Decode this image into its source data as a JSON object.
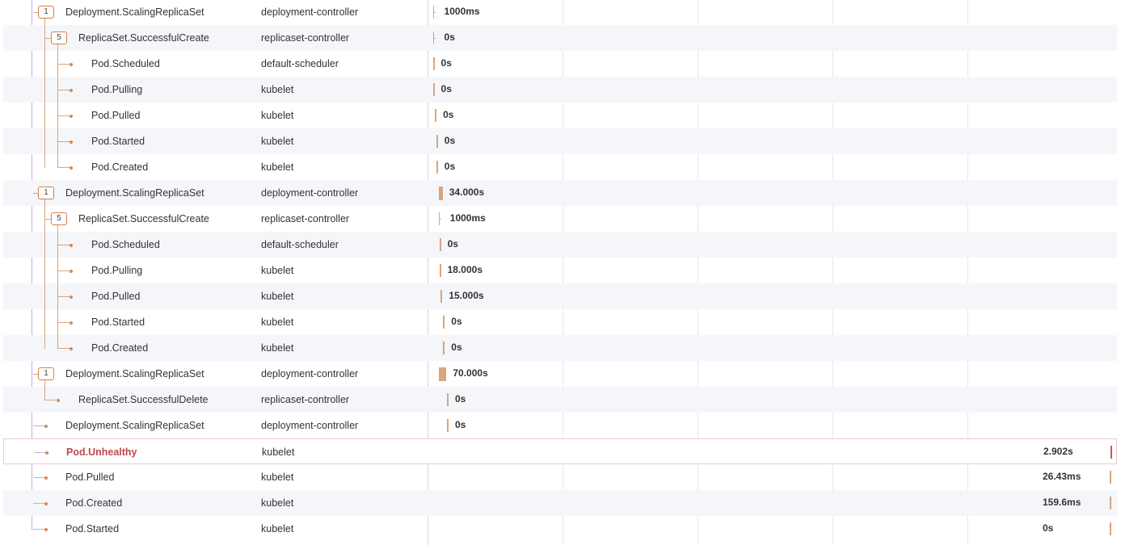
{
  "colors": {
    "bar": "#d9a47e",
    "tree_line": "#d9a47e",
    "root_line": "#c3aee0",
    "unhealthy": "#c0484f",
    "unhealthy_bar": "#d9505c"
  },
  "rows": [
    {
      "level": 1,
      "count": "1",
      "name": "Deployment.ScalingReplicaSet",
      "source": "deployment-controller",
      "duration": "1000ms",
      "bar_kind": "tick",
      "bar_start": 0.003,
      "bar_width": 0.003
    },
    {
      "level": 2,
      "count": "5",
      "name": "ReplicaSet.SuccessfulCreate",
      "source": "replicaset-controller",
      "duration": "0s",
      "bar_kind": "tick",
      "bar_start": 0.003,
      "bar_width": 0.003
    },
    {
      "level": 3,
      "name": "Pod.Scheduled",
      "source": "default-scheduler",
      "duration": "0s",
      "bar_kind": "thin",
      "bar_start": 0.003,
      "bar_width": 0
    },
    {
      "level": 3,
      "name": "Pod.Pulling",
      "source": "kubelet",
      "duration": "0s",
      "bar_kind": "thin",
      "bar_start": 0.003,
      "bar_width": 0
    },
    {
      "level": 3,
      "name": "Pod.Pulled",
      "source": "kubelet",
      "duration": "0s",
      "bar_kind": "thin",
      "bar_start": 0.006,
      "bar_width": 0
    },
    {
      "level": 3,
      "name": "Pod.Started",
      "source": "kubelet",
      "duration": "0s",
      "bar_kind": "thin",
      "bar_start": 0.008,
      "bar_width": 0
    },
    {
      "level": 3,
      "name": "Pod.Created",
      "source": "kubelet",
      "duration": "0s",
      "bar_kind": "thin",
      "bar_start": 0.008,
      "bar_width": 0
    },
    {
      "level": 1,
      "count": "1",
      "name": "Deployment.ScalingReplicaSet",
      "source": "deployment-controller",
      "duration": "34.000s",
      "bar_kind": "block",
      "bar_start": 0.0115,
      "bar_width": 0.0055
    },
    {
      "level": 2,
      "count": "5",
      "name": "ReplicaSet.SuccessfulCreate",
      "source": "replicaset-controller",
      "duration": "1000ms",
      "bar_kind": "tick",
      "bar_start": 0.0115,
      "bar_width": 0.003
    },
    {
      "level": 3,
      "name": "Pod.Scheduled",
      "source": "default-scheduler",
      "duration": "0s",
      "bar_kind": "thin",
      "bar_start": 0.0125,
      "bar_width": 0
    },
    {
      "level": 3,
      "name": "Pod.Pulling",
      "source": "kubelet",
      "duration": "18.000s",
      "bar_kind": "thin",
      "bar_start": 0.0125,
      "bar_width": 0
    },
    {
      "level": 3,
      "name": "Pod.Pulled",
      "source": "kubelet",
      "duration": "15.000s",
      "bar_kind": "thin",
      "bar_start": 0.0145,
      "bar_width": 0
    },
    {
      "level": 3,
      "name": "Pod.Started",
      "source": "kubelet",
      "duration": "0s",
      "bar_kind": "thin",
      "bar_start": 0.018,
      "bar_width": 0
    },
    {
      "level": 3,
      "name": "Pod.Created",
      "source": "kubelet",
      "duration": "0s",
      "bar_kind": "thin",
      "bar_start": 0.018,
      "bar_width": 0
    },
    {
      "level": 1,
      "count": "1",
      "name": "Deployment.ScalingReplicaSet",
      "source": "deployment-controller",
      "duration": "70.000s",
      "bar_kind": "block",
      "bar_start": 0.0115,
      "bar_width": 0.0113
    },
    {
      "level": 2,
      "name": "ReplicaSet.SuccessfulDelete",
      "source": "replicaset-controller",
      "duration": "0s",
      "bar_kind": "thin",
      "bar_start": 0.0235,
      "bar_width": 0
    },
    {
      "level": 1,
      "name": "Deployment.ScalingReplicaSet",
      "source": "deployment-controller",
      "duration": "0s",
      "bar_kind": "thin",
      "bar_start": 0.0235,
      "bar_width": 0
    },
    {
      "level": 1,
      "name": "Pod.Unhealthy",
      "source": "kubelet",
      "duration": "2.902s",
      "bar_kind": "thin",
      "bar_start": 0.9887,
      "bar_width": 0,
      "highlight": true
    },
    {
      "level": 1,
      "name": "Pod.Pulled",
      "source": "kubelet",
      "duration": "26.43ms",
      "bar_kind": "thin",
      "bar_start": 0.9887,
      "bar_width": 0
    },
    {
      "level": 1,
      "name": "Pod.Created",
      "source": "kubelet",
      "duration": "159.6ms",
      "bar_kind": "thin",
      "bar_start": 0.9887,
      "bar_width": 0
    },
    {
      "level": 1,
      "name": "Pod.Started",
      "source": "kubelet",
      "duration": "0s",
      "bar_kind": "thin",
      "bar_start": 0.9887,
      "bar_width": 0
    }
  ]
}
